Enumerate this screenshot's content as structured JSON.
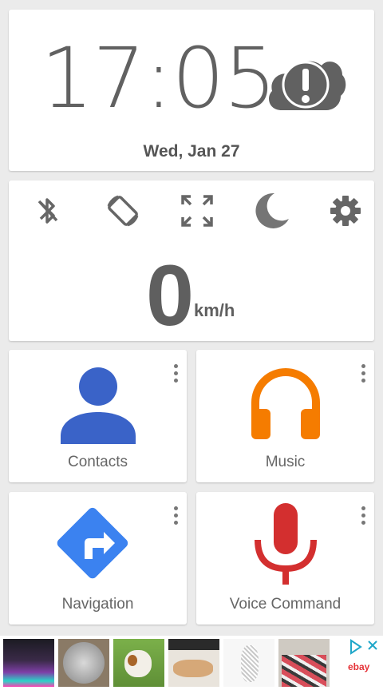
{
  "clock": {
    "time": "17:05",
    "date": "Wed, Jan 27"
  },
  "weather": {
    "icon": "cloud-alert-icon",
    "color": "#616161"
  },
  "quick_controls": [
    {
      "name": "bluetooth-icon"
    },
    {
      "name": "screen-rotation-icon"
    },
    {
      "name": "fullscreen-icon"
    },
    {
      "name": "night-mode-icon"
    },
    {
      "name": "settings-icon"
    }
  ],
  "speed": {
    "value": "0",
    "unit": "km/h"
  },
  "tiles": [
    {
      "label": "Contacts",
      "icon": "contacts-icon",
      "color": "#3a63c8"
    },
    {
      "label": "Music",
      "icon": "headphones-icon",
      "color": "#f57c00"
    },
    {
      "label": "Navigation",
      "icon": "navigation-icon",
      "color": "#3b82f0"
    },
    {
      "label": "Voice Command",
      "icon": "microphone-icon",
      "color": "#d32f2f"
    }
  ],
  "ad": {
    "brand": "ebay",
    "brand_color": "#e53238"
  }
}
